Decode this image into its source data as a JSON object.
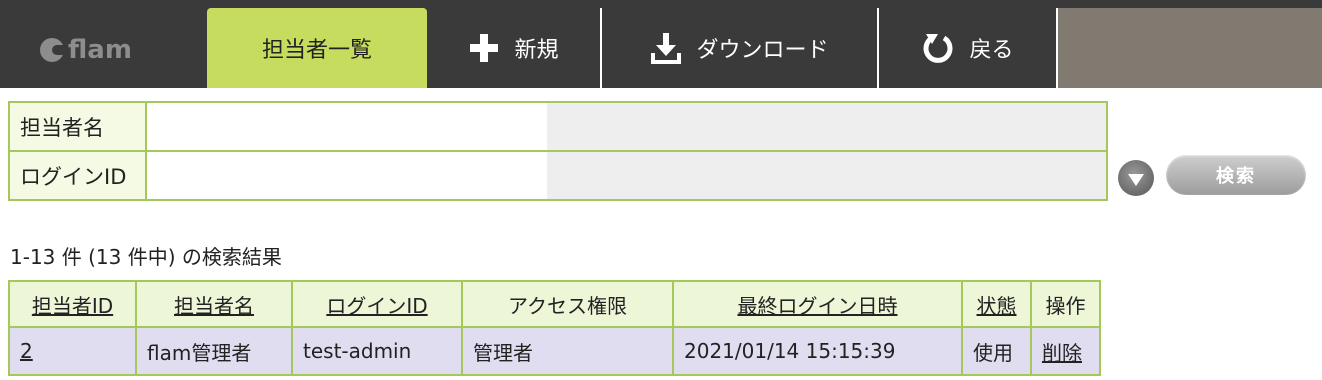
{
  "app": {
    "logo_text": "flam"
  },
  "nav": {
    "tabs": [
      {
        "label": "担当者一覧",
        "icon": ""
      },
      {
        "label": "新規",
        "icon": "plus-icon"
      },
      {
        "label": "ダウンロード",
        "icon": "download-icon"
      },
      {
        "label": "戻る",
        "icon": "refresh-back-icon"
      }
    ],
    "active_tab": "担当者一覧",
    "active_color": "#c6dc5e"
  },
  "search": {
    "fields": [
      {
        "label": "担当者名",
        "value": ""
      },
      {
        "label": "ログインID",
        "value": ""
      }
    ],
    "button_label": "検索"
  },
  "results": {
    "summary": "1-13 件 (13 件中) の検索結果",
    "columns": [
      "担当者ID",
      "担当者名",
      "ログインID",
      "アクセス権限",
      "最終ログイン日時",
      "状態",
      "操作"
    ],
    "rows": [
      {
        "id": "2",
        "name": "flam管理者",
        "login_id": "test-admin",
        "access": "管理者",
        "last_login": "2021/01/14 15:15:39",
        "status": "使用",
        "action": "削除"
      }
    ]
  }
}
